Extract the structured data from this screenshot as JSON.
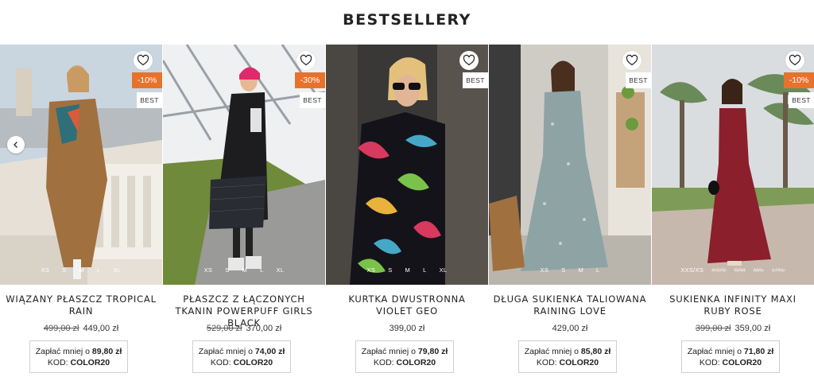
{
  "section": {
    "title": "BESTSELLERY"
  },
  "products": [
    {
      "name": "WIĄZANY PŁASZCZ TROPICAL RAIN",
      "old_price": "499,00 zł",
      "price": "449,00 zł",
      "discount": "-10%",
      "best": "BEST",
      "sizes": [
        {
          "s": "XS"
        },
        {
          "s": "S"
        },
        {
          "s": "M"
        },
        {
          "s": "L"
        },
        {
          "s": "XL"
        }
      ],
      "promo_text": "Zapłać mniej o",
      "promo_amount": "89,80 zł",
      "code_label": "KOD:",
      "code": "COLOR20"
    },
    {
      "name": "PŁASZCZ Z ŁĄCZONYCH TKANIN POWERPUFF GIRLS BLACK",
      "old_price": "529,00 zł",
      "price": "370,00 zł",
      "discount": "-30%",
      "best": "BEST",
      "sizes": [
        {
          "s": "XS"
        },
        {
          "s": "S"
        },
        {
          "s": "M"
        },
        {
          "s": "L"
        },
        {
          "s": "XL"
        }
      ],
      "promo_text": "Zapłać mniej o",
      "promo_amount": "74,00 zł",
      "code_label": "KOD:",
      "code": "COLOR20"
    },
    {
      "name": "KURTKA DWUSTRONNA VIOLET GEO",
      "old_price": "",
      "price": "399,00 zł",
      "discount": "",
      "best": "BEST",
      "sizes": [
        {
          "s": "XS"
        },
        {
          "s": "S"
        },
        {
          "s": "M"
        },
        {
          "s": "L"
        },
        {
          "s": "XL"
        }
      ],
      "promo_text": "Zapłać mniej o",
      "promo_amount": "79,80 zł",
      "code_label": "KOD:",
      "code": "COLOR20"
    },
    {
      "name": "DŁUGA SUKIENKA TALIOWANA RAINING LOVE",
      "old_price": "",
      "price": "429,00 zł",
      "discount": "",
      "best": "BEST",
      "sizes": [
        {
          "s": "XS"
        },
        {
          "s": "S"
        },
        {
          "s": "M"
        },
        {
          "s": "L"
        }
      ],
      "promo_text": "Zapłać mniej o",
      "promo_amount": "85,80 zł",
      "code_label": "KOD:",
      "code": "COLOR20"
    },
    {
      "name": "SUKIENKA INFINITY MAXI RUBY ROSE",
      "old_price": "399,00 zł",
      "price": "359,00 zł",
      "discount": "-10%",
      "best": "BEST",
      "sizes": [
        {
          "s": "XXS/XS"
        },
        {
          "s": "XS/S",
          "na": true
        },
        {
          "s": "S/M",
          "na": true
        },
        {
          "s": "M/L",
          "na": true
        },
        {
          "s": "L/XL",
          "na": true
        }
      ],
      "promo_text": "Zapłać mniej o",
      "promo_amount": "71,80 zł",
      "code_label": "KOD:",
      "code": "COLOR20"
    }
  ],
  "icons": {
    "wishlist": "heart-icon",
    "prev": "chevron-left-icon"
  },
  "colors": {
    "discount_badge": "#e8722c",
    "text": "#222222",
    "promo_border": "#cfcfcf"
  }
}
